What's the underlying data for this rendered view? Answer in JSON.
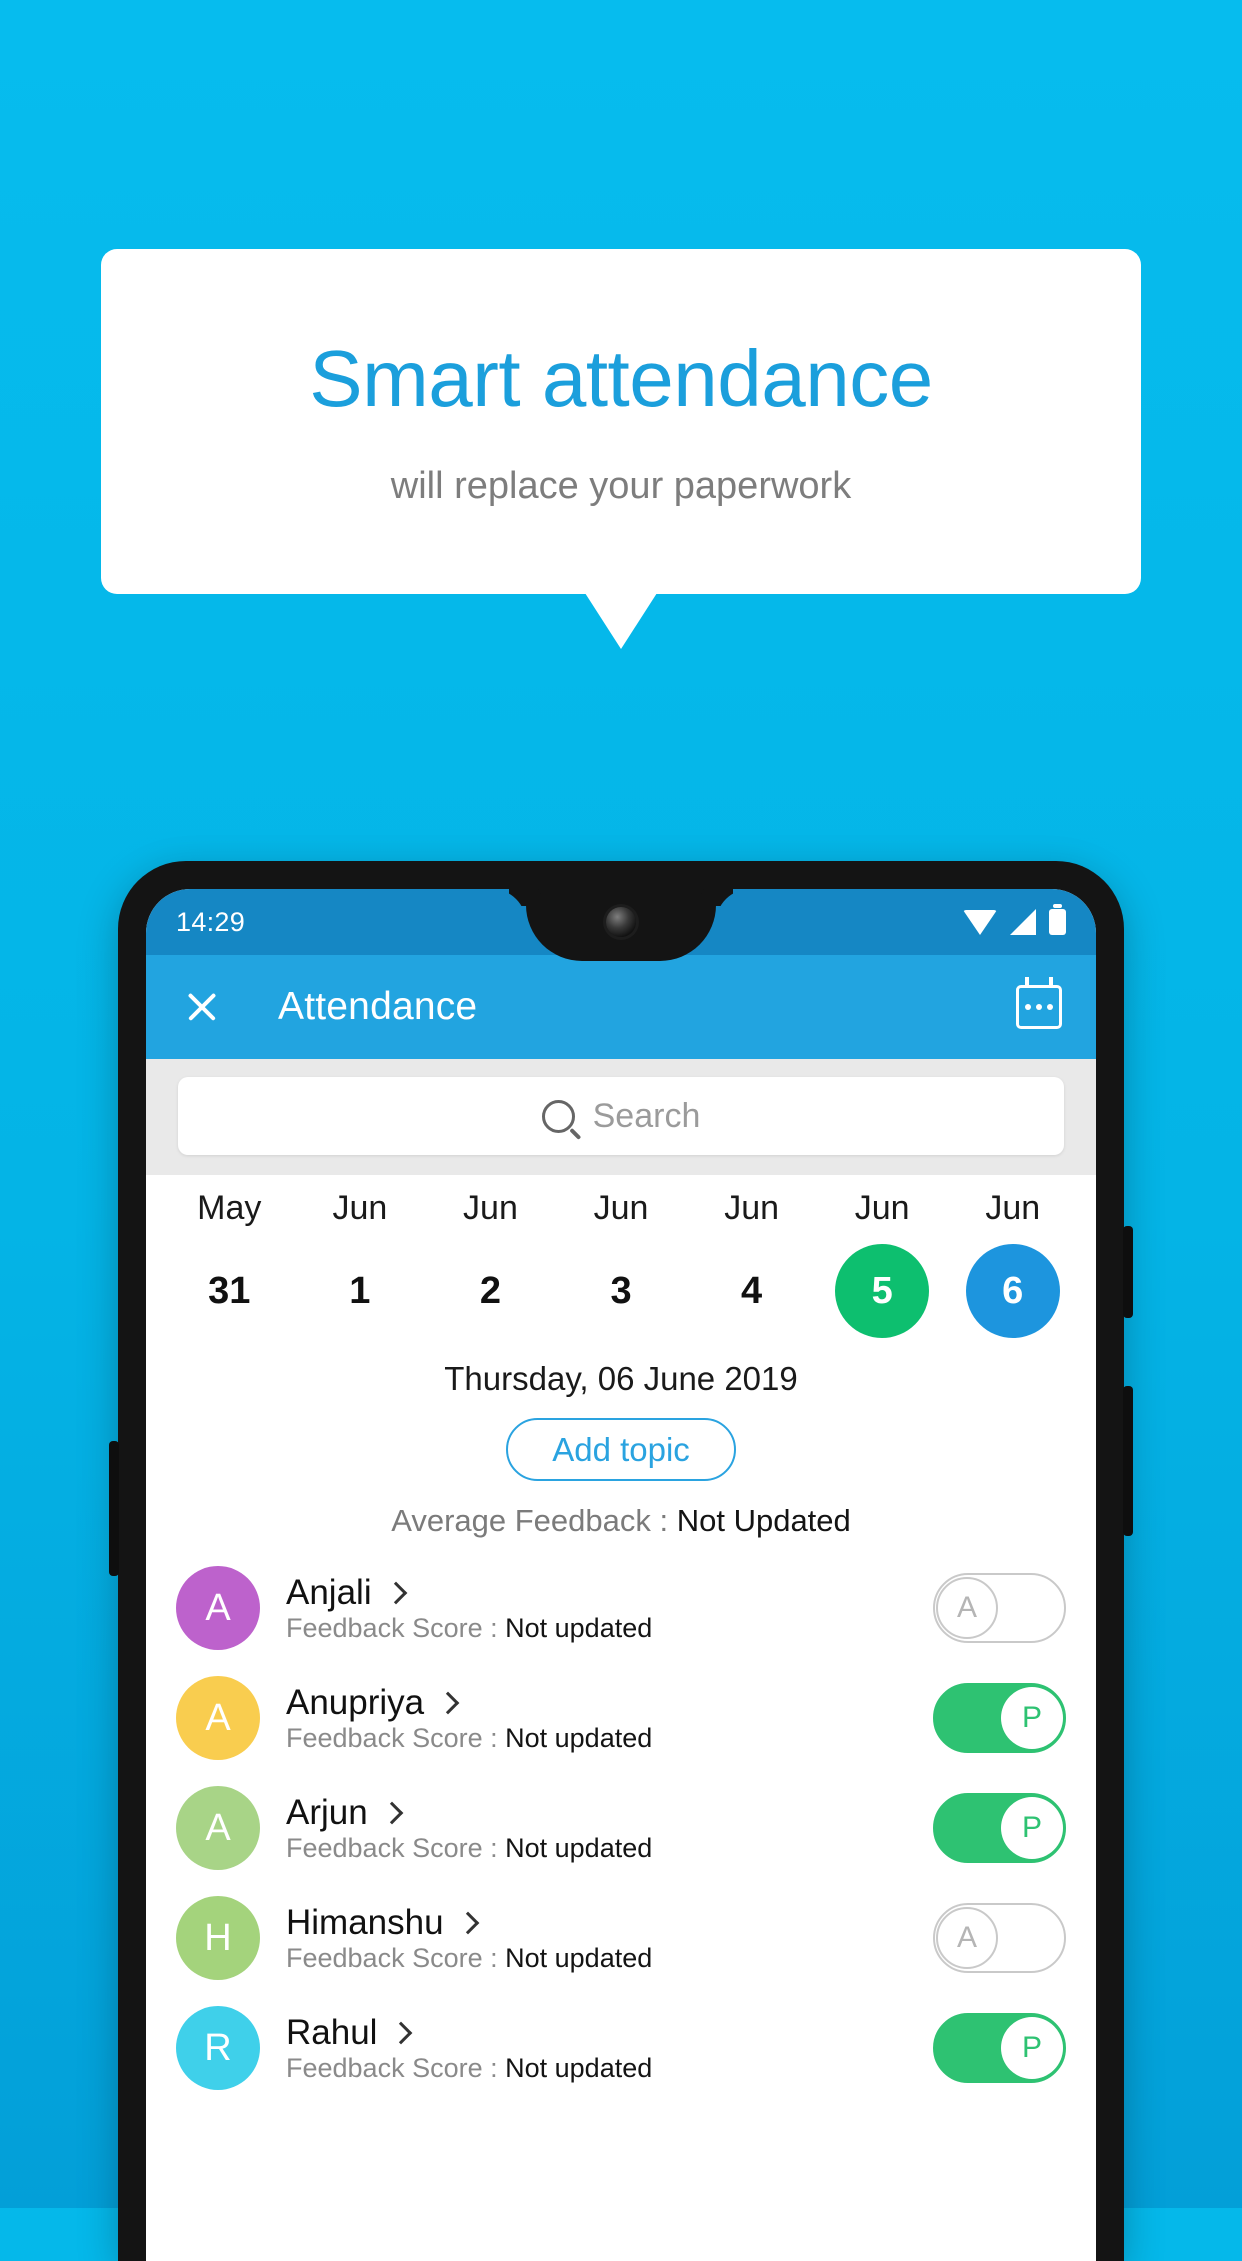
{
  "promo": {
    "headline": "Smart attendance",
    "subhead": "will replace your paperwork",
    "bg_color": "#06bcee",
    "headline_color": "#1b9fdc"
  },
  "phone": {
    "statusbar": {
      "time": "14:29",
      "icons": [
        "wifi-icon",
        "signal-icon",
        "battery-icon"
      ]
    },
    "appbar": {
      "close_icon": "close-icon",
      "title": "Attendance",
      "calendar_icon": "calendar-icon",
      "bg_color": "#22a4e0"
    },
    "search": {
      "placeholder": "Search",
      "icon": "search-icon"
    },
    "calendar_strip": [
      {
        "month": "May",
        "day": "31",
        "state": "none"
      },
      {
        "month": "Jun",
        "day": "1",
        "state": "none"
      },
      {
        "month": "Jun",
        "day": "2",
        "state": "none"
      },
      {
        "month": "Jun",
        "day": "3",
        "state": "none"
      },
      {
        "month": "Jun",
        "day": "4",
        "state": "none"
      },
      {
        "month": "Jun",
        "day": "5",
        "state": "green"
      },
      {
        "month": "Jun",
        "day": "6",
        "state": "blue"
      }
    ],
    "selected_date": "Thursday, 06 June 2019",
    "add_topic_label": "Add topic",
    "average_feedback": {
      "label": "Average Feedback : ",
      "value": "Not Updated"
    },
    "score_label": "Feedback Score : ",
    "students": [
      {
        "name": "Anjali",
        "initial": "A",
        "avatar_color": "#bd62cc",
        "score": "Not updated",
        "status": "A",
        "present": false
      },
      {
        "name": "Anupriya",
        "initial": "A",
        "avatar_color": "#f9cd4f",
        "score": "Not updated",
        "status": "P",
        "present": true
      },
      {
        "name": "Arjun",
        "initial": "A",
        "avatar_color": "#a8d487",
        "score": "Not updated",
        "status": "P",
        "present": true
      },
      {
        "name": "Himanshu",
        "initial": "H",
        "avatar_color": "#a4d37c",
        "score": "Not updated",
        "status": "A",
        "present": false
      },
      {
        "name": "Rahul",
        "initial": "R",
        "avatar_color": "#3fd0ea",
        "score": "Not updated",
        "status": "P",
        "present": true
      }
    ]
  }
}
